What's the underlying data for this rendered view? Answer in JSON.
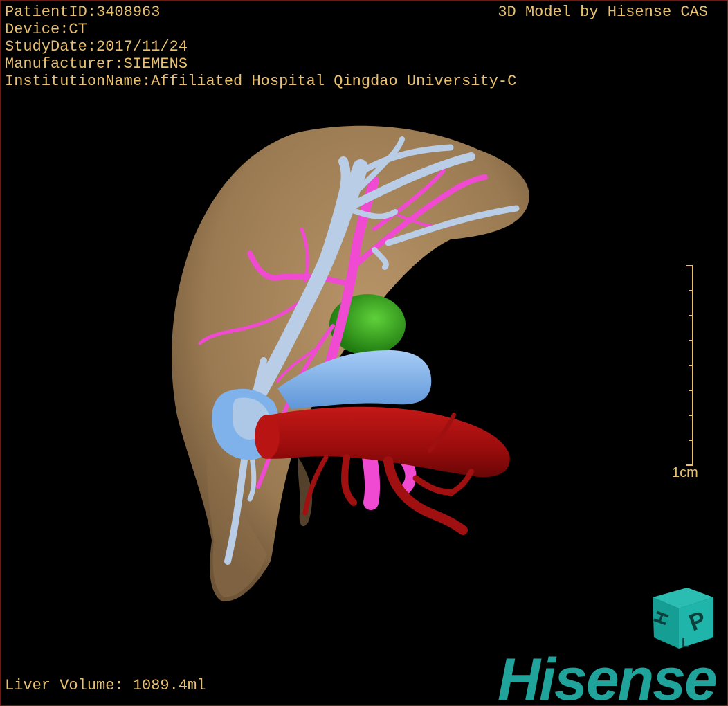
{
  "info": {
    "patient_id": "PatientID:3408963",
    "device": "Device:CT",
    "study_date": "StudyDate:2017/11/24",
    "manufacturer": "Manufacturer:SIEMENS",
    "institution": "InstitutionName:Affiliated Hospital Qingdao University-C"
  },
  "credit": "3D Model by Hisense CAS",
  "volume": "Liver Volume: 1089.4ml",
  "scale": {
    "label": "1cm"
  },
  "orientation_cube": {
    "face_top": "H",
    "face_right": "P",
    "face_bottom": "L"
  },
  "brand": "Hisense",
  "colors": {
    "overlay_text": "#e8c070",
    "liver": "#a5845c",
    "portal_vein": "#b9cde6",
    "ivc": "#7fb2ea",
    "hepatic_artery": "#f04ad2",
    "aorta": "#a01010",
    "gallbladder": "#3ea81e",
    "brand": "#1fa39a"
  }
}
